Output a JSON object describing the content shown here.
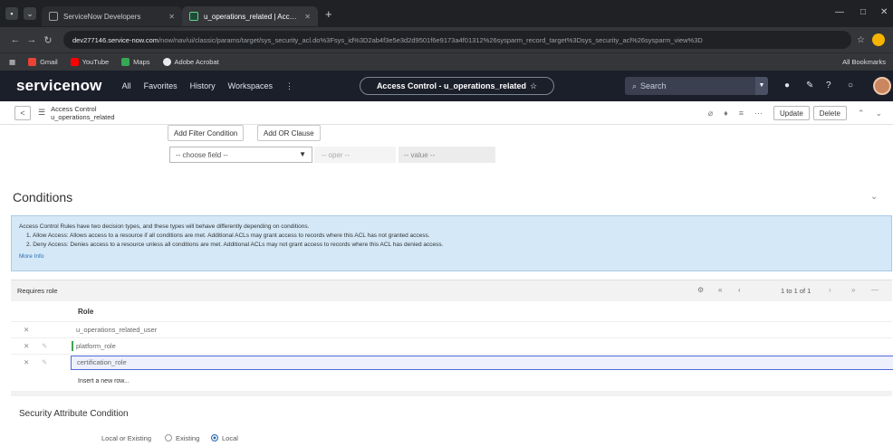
{
  "browser": {
    "tabs": [
      {
        "title": "ServiceNow Developers"
      },
      {
        "title": "u_operations_related | Access C"
      }
    ],
    "url_host": "dev277146.service-now.com",
    "url_path": "/now/nav/ui/classic/params/target/sys_security_acl.do%3Fsys_id%3D2ab4f3e5e3d2d9501f6e9173a4f01312%26sysparm_record_target%3Dsys_security_acl%26sysparm_view%3D",
    "bookmarks": [
      "Gmail",
      "YouTube",
      "Maps",
      "Adobe Acrobat"
    ],
    "all_bookmarks": "All Bookmarks"
  },
  "header": {
    "logo": "servicenow",
    "nav": [
      "All",
      "Favorites",
      "History",
      "Workspaces"
    ],
    "context_title": "Access Control - u_operations_related",
    "search_placeholder": "Search"
  },
  "form": {
    "record_type": "Access Control",
    "record_name": "u_operations_related",
    "update_label": "Update",
    "delete_label": "Delete"
  },
  "filter": {
    "add_filter_condition": "Add Filter Condition",
    "add_or_clause": "Add OR Clause",
    "choose_field": "-- choose field --",
    "operator": "-- oper --",
    "value": "-- value --"
  },
  "conditions": {
    "title": "Conditions",
    "info_intro": "Access Control Rules have two decision types, and these types will behave differently depending on conditions.",
    "info_items": [
      "1. Allow Access: Allows access to a resource if all conditions are met. Additional ACLs may grant access to records where this ACL has not granted access.",
      "2. Deny Access: Denies access to a resource unless all conditions are met. Additional ACLs may not grant access to records where this ACL has denied access."
    ],
    "more_info": "More Info"
  },
  "requires_role": {
    "title": "Requires role",
    "pager": "1 to 1 of 1",
    "column": "Role",
    "rows": [
      "u_operations_related_user",
      "platform_role",
      "certification_role"
    ],
    "insert_row": "Insert a new row..."
  },
  "security_attribute": {
    "title": "Security Attribute Condition",
    "label": "Local or Existing",
    "options": [
      "Existing",
      "Local"
    ],
    "selected": "Local"
  }
}
